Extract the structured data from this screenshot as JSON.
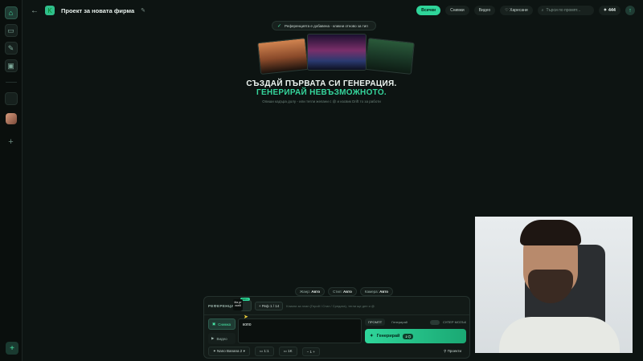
{
  "topbar": {
    "project_title": "Проект за новата фирма",
    "filters": [
      "Всички",
      "Снимки",
      "Видео",
      "Харесани"
    ],
    "active_filter": "Всички",
    "search_placeholder": "Търси по промпт...",
    "credits": "444"
  },
  "toast": {
    "text": "Референцията е добавена - кликни отново за тип"
  },
  "hero": {
    "title": "СЪЗДАЙ ПЪРВАТА СИ ГЕНЕРАЦИЯ.",
    "subtitle": "ГЕНЕРИРАЙ НЕВЪЗМОЖНОТО.",
    "hint": "Опиши кадъра долу - или тегли желани с @ и изсвик Drift то за работи"
  },
  "pills": [
    {
      "label": "Жанр:",
      "value": "Авто"
    },
    {
      "label": "Стил:",
      "value": "Авто"
    },
    {
      "label": "Камера:",
      "value": "Авто"
    }
  ],
  "panel": {
    "ref_label": "РЕФЕРЕНЦИИ",
    "ref_badge": "Авто",
    "ref_tooltip": "Ма рт лкей",
    "ref_chip": "+ Реф 1 / 14",
    "ref_hint": "Кликни за план (Герой / Стил / Средата), тегли ще ден и @",
    "types": [
      {
        "label": "Снимка",
        "icon": "image-icon",
        "active": true
      },
      {
        "label": "Видео",
        "icon": "video-icon",
        "active": false
      }
    ],
    "prompt_value": "копо",
    "modes": [
      "ПРОМПТ",
      "Генерирай"
    ],
    "super_mode": "СУПЕР МОЗЪК",
    "generate_label": "Генерирай",
    "generate_cost": "2 ⬡",
    "model": "Nano Banana 2",
    "ratio": "1:1",
    "resolution": "1K",
    "count": "1",
    "projects_link": "Проекти"
  },
  "colors": {
    "accent": "#2fd59a",
    "background": "#0d1412",
    "panel": "#121a17"
  }
}
